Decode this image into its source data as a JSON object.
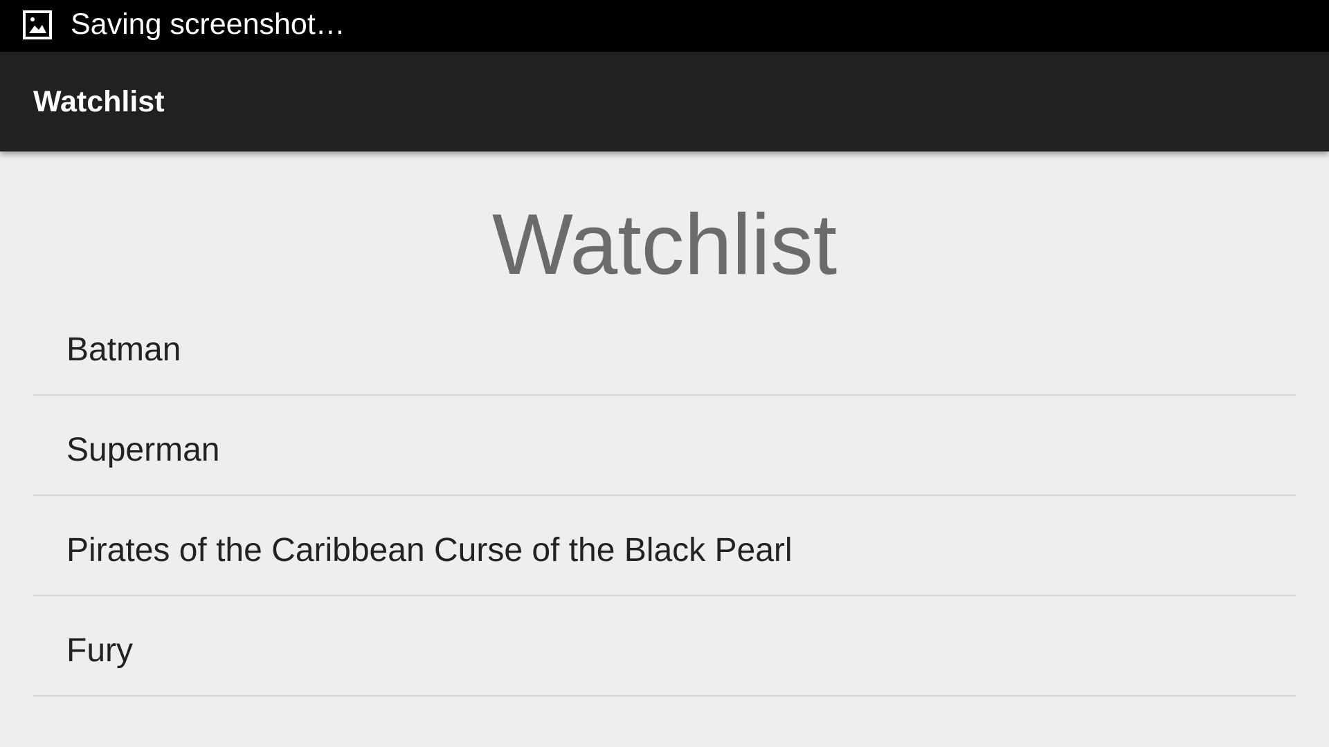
{
  "status_bar": {
    "notification_icon": "image-icon",
    "notification_text": "Saving screenshot…"
  },
  "action_bar": {
    "title": "Watchlist"
  },
  "main": {
    "heading": "Watchlist",
    "items": [
      {
        "label": "Batman"
      },
      {
        "label": "Superman"
      },
      {
        "label": "Pirates of the Caribbean Curse of the Black Pearl"
      },
      {
        "label": "Fury"
      }
    ]
  },
  "colors": {
    "status_bar_bg": "#000000",
    "action_bar_bg": "#212121",
    "content_bg": "#eeeeee",
    "heading_text": "#6b6b6b",
    "item_text": "#222222",
    "divider": "#d4d4d4"
  }
}
